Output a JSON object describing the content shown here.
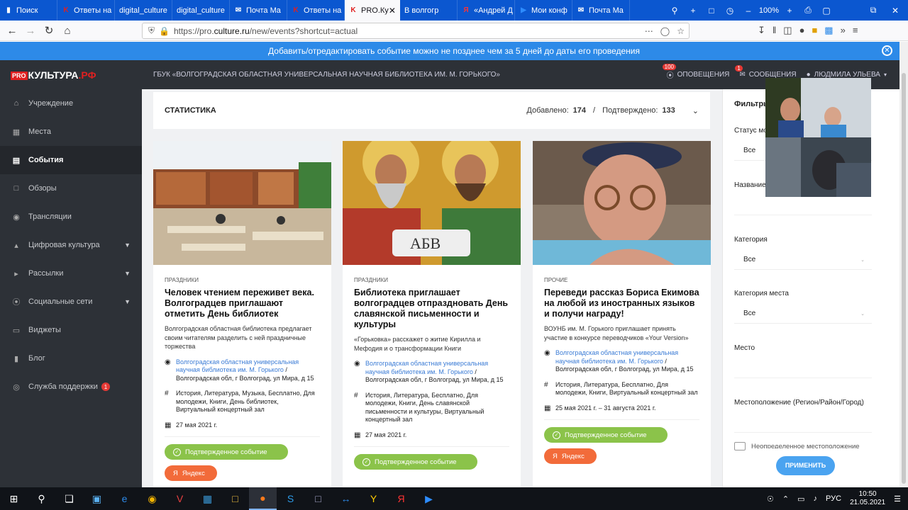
{
  "browser": {
    "tabs": [
      {
        "label": "Поиск",
        "icon": "bookmark-icon",
        "color": "#ffffff"
      },
      {
        "label": "Ответы на",
        "icon": "k-icon",
        "color": "#e02020"
      },
      {
        "label": "digital_culture",
        "icon": "none",
        "color": "#ffffff"
      },
      {
        "label": "digital_culture",
        "icon": "none",
        "color": "#ffffff"
      },
      {
        "label": "Почта Ma",
        "icon": "mail-icon",
        "color": "#ffffff"
      },
      {
        "label": "Ответы на",
        "icon": "k-icon",
        "color": "#e02020"
      },
      {
        "label": "PRO.Ку",
        "icon": "k-icon",
        "color": "#e02020",
        "active": true
      },
      {
        "label": "В волгогр",
        "icon": "none",
        "color": "#ffffff"
      },
      {
        "label": "«Андрей Д",
        "icon": "yandex-icon",
        "color": "#ff3333"
      },
      {
        "label": "Мои конф",
        "icon": "zoom-icon",
        "color": "#2d8cff"
      },
      {
        "label": "Почта Ma",
        "icon": "mail-icon",
        "color": "#ffffff"
      }
    ],
    "zoom": "100%",
    "url_prefix": "https://pro.",
    "url_domain": "culture.ru",
    "url_path": "/new/events?shortcut=actual"
  },
  "banner": {
    "text": "Добавить/отредактировать событие можно не позднее чем за 5 дней до даты его проведения"
  },
  "header": {
    "logo_pro": "PRO",
    "logo_main": "КУЛЬТУРА",
    "logo_rf": ".РФ",
    "org": "ГБУК «ВОЛГОГРАДСКАЯ ОБЛАСТНАЯ УНИВЕРСАЛЬНАЯ НАУЧНАЯ БИБЛИОТЕКА ИМ. М. ГОРЬКОГО»",
    "notifications_label": "ОПОВЕЩЕНИЯ",
    "notifications_count": "100",
    "messages_label": "СООБЩЕНИЯ",
    "messages_count": "1",
    "user_label": "ЛЮДМИЛА УЛЬЕВА"
  },
  "sidebar": {
    "items": [
      {
        "label": "Учреждение",
        "icon": "home-icon"
      },
      {
        "label": "Места",
        "icon": "building-icon"
      },
      {
        "label": "События",
        "icon": "calendar-icon",
        "active": true
      },
      {
        "label": "Обзоры",
        "icon": "comment-icon"
      },
      {
        "label": "Трансляции",
        "icon": "broadcast-icon"
      },
      {
        "label": "Цифровая культура",
        "icon": "chart-icon",
        "has_arrow": true
      },
      {
        "label": "Рассылки",
        "icon": "megaphone-icon",
        "has_arrow": true
      },
      {
        "label": "Социальные сети",
        "icon": "share-icon",
        "has_arrow": true
      },
      {
        "label": "Виджеты",
        "icon": "monitor-icon"
      },
      {
        "label": "Блог",
        "icon": "book-icon"
      },
      {
        "label": "Служба поддержки",
        "icon": "lifebuoy-icon",
        "badge": "1"
      }
    ]
  },
  "stats": {
    "title": "СТАТИСТИКА",
    "added_label": "Добавлено:",
    "added_value": "174",
    "sep": "/",
    "confirmed_label": "Подтверждено:",
    "confirmed_value": "133"
  },
  "cards": [
    {
      "category": "ПРАЗДНИКИ",
      "title": "Человек чтением переживет века. Волгоградцев приглашают отметить День библиотек",
      "desc": "Волгоградская областная библиотека предлагает своим читателям разделить с ней праздничные торжества",
      "place_link": "Волгоградская областная универсальная научная библиотека им. М. Горького",
      "place_addr": " / Волгоградская обл, г Волгоград, ул Мира, д 15",
      "tags": "История, Литература, Музыка, Бесплатно, Для молодежи, Книги, День библиотек, Виртуальный концертный зал",
      "date": "27 мая 2021 г.",
      "status": "Подтвержденное событие",
      "extra": "Яндекс"
    },
    {
      "category": "ПРАЗДНИКИ",
      "title": "Библиотека приглашает волгоградцев отпраздновать День славянской письменности и культуры",
      "desc": "«Горьковка» расскажет о житие Кирилла и Мефодия и о трансформации Книги",
      "place_link": "Волгоградская областная универсальная научная библиотека им. М. Горького",
      "place_addr": " / Волгоградская обл, г Волгоград, ул Мира, д 15",
      "tags": "История, Литература, Бесплатно, Для молодежи, Книги, День славянской письменности и культуры, Виртуальный концертный зал",
      "date": "27 мая 2021 г.",
      "status": "Подтвержденное событие"
    },
    {
      "category": "ПРОЧИЕ",
      "title": "Переведи рассказ Бориса Екимова на любой из иностранных языков и получи награду!",
      "desc": "ВОУНБ им. М. Горького приглашает принять участие в конкурсе переводчиков «Your Version»",
      "place_link": "Волгоградская областная универсальная научная библиотека им. М. Горького",
      "place_addr": " / Волгоградская обл, г Волгоград, ул Мира, д 15",
      "tags": "История, Литература, Бесплатно, Для молодежи, Книги, Виртуальный концертный зал",
      "date": "25 мая 2021 г. – 31 августа 2021 г.",
      "status": "Подтвержденное событие",
      "extra": "Яндекс"
    }
  ],
  "filters": {
    "title": "Фильтры",
    "status_label": "Статус мо",
    "status_value": "Все",
    "name_label": "Название",
    "category_label": "Категория",
    "category_value": "Все",
    "place_category_label": "Категория места",
    "place_category_value": "Все",
    "place_label": "Место",
    "location_label": "Местоположение (Регион/Район/Город)",
    "unknown_location_label": "Неопределенное местоположение",
    "apply_label": "ПРИМЕНИТЬ"
  },
  "taskbar": {
    "lang": "РУС",
    "time": "10:50",
    "date": "21.05.2021"
  }
}
